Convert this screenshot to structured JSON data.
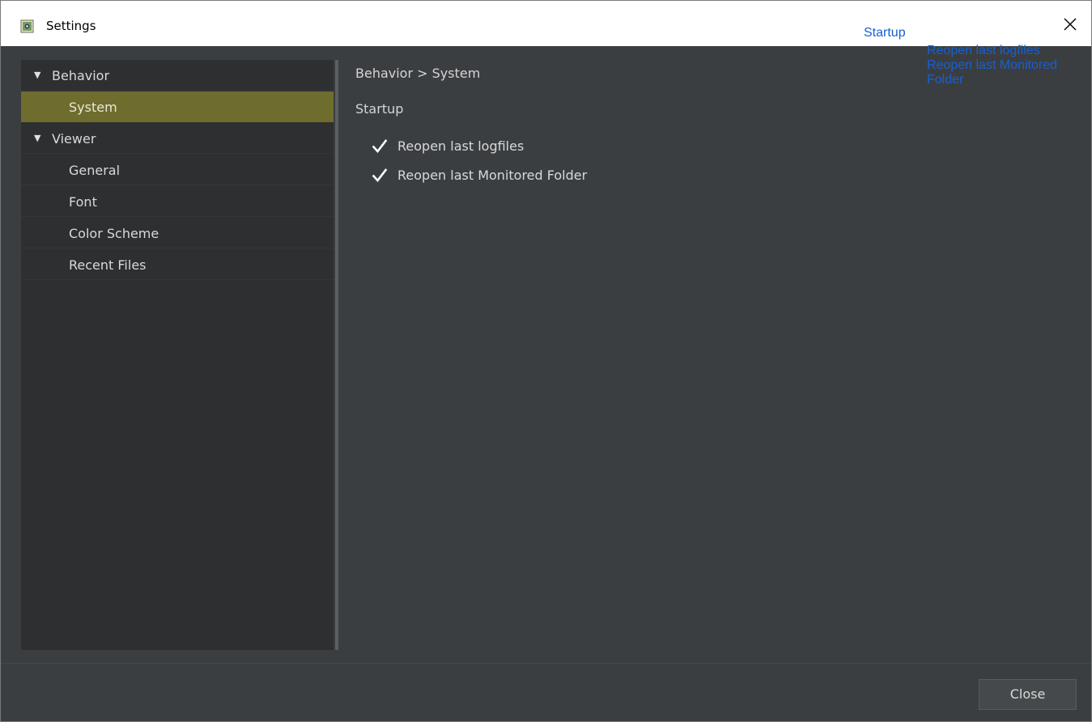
{
  "window": {
    "title": "Settings",
    "close_icon": "close-icon"
  },
  "overlay": {
    "startup_label": "Startup",
    "items": [
      "Reopen last logfiles",
      "Reopen last Monitored Folder"
    ]
  },
  "tree": {
    "items": [
      {
        "label": "Behavior",
        "level": 0,
        "expanded": true,
        "selected": false
      },
      {
        "label": "System",
        "level": 1,
        "selected": true
      },
      {
        "label": "Viewer",
        "level": 0,
        "expanded": true,
        "selected": false
      },
      {
        "label": "General",
        "level": 1,
        "selected": false
      },
      {
        "label": "Font",
        "level": 1,
        "selected": false
      },
      {
        "label": "Color Scheme",
        "level": 1,
        "selected": false
      },
      {
        "label": "Recent Files",
        "level": 1,
        "selected": false
      }
    ]
  },
  "content": {
    "breadcrumb": "Behavior > System",
    "section_title": "Startup",
    "checkboxes": [
      {
        "label": "Reopen last logfiles",
        "checked": true
      },
      {
        "label": "Reopen last Monitored Folder",
        "checked": true
      }
    ]
  },
  "footer": {
    "close_label": "Close"
  },
  "colors": {
    "selected_row": "#6f6d2e",
    "tree_bg": "#2d2f31",
    "panel_bg": "#3b3e41",
    "overlay_text": "#1560d4"
  }
}
